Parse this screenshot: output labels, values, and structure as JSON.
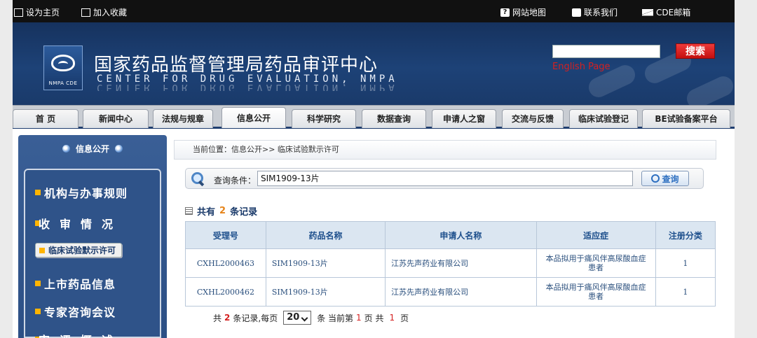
{
  "topbar": {
    "set_home": "设为主页",
    "add_favorite": "加入收藏",
    "sitemap": "网站地图",
    "contact": "联系我们",
    "mail": "CDE邮箱"
  },
  "header": {
    "logo_text": "NMPA CDE",
    "title": "国家药品监督管理局药品审评中心",
    "subtitle": "CENTER FOR DRUG EVALUATION, NMPA",
    "search_button": "搜索",
    "search_value": "",
    "english_link": "English Page"
  },
  "nav": {
    "tabs": [
      {
        "label": "首  页"
      },
      {
        "label": "新闻中心"
      },
      {
        "label": "法规与规章"
      },
      {
        "label": "信息公开"
      },
      {
        "label": "科学研究"
      },
      {
        "label": "数据查询"
      },
      {
        "label": "申请人之窗"
      },
      {
        "label": "交流与反馈"
      },
      {
        "label": "临床试验登记"
      },
      {
        "label": "BE试验备案平台"
      }
    ],
    "active": "信息公开"
  },
  "sidebar": {
    "title": "信息公开",
    "items": [
      {
        "label": "机构与办事规则"
      },
      {
        "label": "收审情况"
      },
      {
        "label": "临床试验默示许可"
      },
      {
        "label": "上市药品信息"
      },
      {
        "label": "专家咨询会议"
      },
      {
        "label": "审评概述"
      }
    ]
  },
  "main": {
    "breadcrumb": "当前位置：信息公开>> 临床试验默示许可",
    "query_label": "查询条件：",
    "query_value": "SIM1909-13片",
    "query_button": "查询",
    "count_prefix": "共有",
    "count_num": "2",
    "count_suffix": "条记录",
    "table": {
      "headers": [
        "受理号",
        "药品名称",
        "申请人名称",
        "适应症",
        "注册分类"
      ],
      "rows": [
        [
          "CXHL2000463",
          "SIM1909-13片",
          "江苏先声药业有限公司",
          "本品拟用于痛风伴高尿酸血症患者",
          "1"
        ],
        [
          "CXHL2000462",
          "SIM1909-13片",
          "江苏先声药业有限公司",
          "本品拟用于痛风伴高尿酸血症患者",
          "1"
        ]
      ]
    },
    "pager": {
      "total_prefix": "共",
      "total_num": "2",
      "total_mid": "条记录,每页",
      "page_size": "20",
      "page_mid": "条 当前第",
      "current_page": "1",
      "page_of": "页 共",
      "total_pages": "1",
      "page_end": "页"
    }
  }
}
